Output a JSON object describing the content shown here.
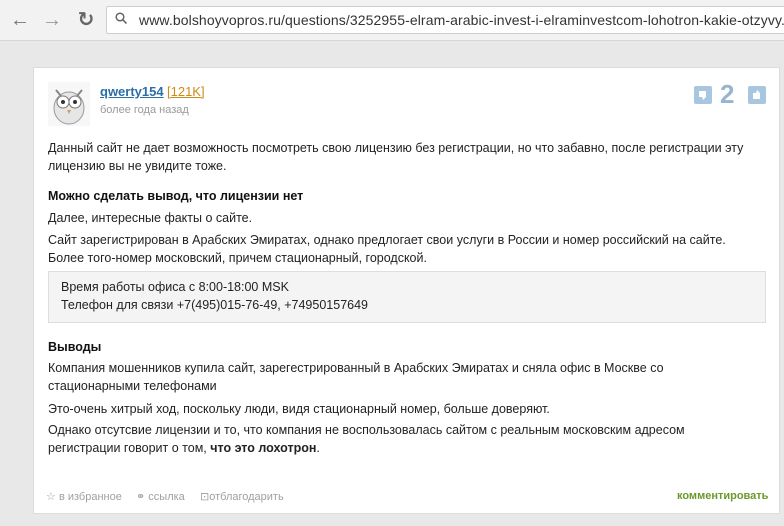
{
  "browser": {
    "url": "www.bolshoyvopros.ru/questions/3252955-elram-arabic-invest-i-elraminvestcom-lohotron-kakie-otzyvy.",
    "back": "←",
    "forward": "→",
    "reload": "↻"
  },
  "post": {
    "username": "qwerty154",
    "karma": "[121K]",
    "time": "более года назад",
    "votes": "2",
    "p1_l1": "Данный сайт не дает возможность посмотреть свою лицензию без регистрации, но что забавно, после регистрации эту",
    "p1_l2": "лицензию вы не увидите тоже.",
    "h1": "Можно сделать вывод, что лицензии нет",
    "p2": "Далее, интересные факты о сайте.",
    "p3_l1": "Сайт зарегистрирован в Арабских Эмиратах, однако предлогает свои услуги в России и номер российский на сайте.",
    "p3_l2": "Более того-номер московский, причем стационарный, городской.",
    "quote_l1": "Время работы офиса с 8:00-18:00 MSK",
    "quote_l2": "Телефон для связи +7(495)015-76-49, +74950157649",
    "h2": "Выводы",
    "p4_l1": "Компания мошенников купила сайт, зарегестрированный в Арабских Эмиратах и сняла офис в Москве со",
    "p4_l2": "стационарными телефонами",
    "p5": "Это-очень хитрый ход, поскольку люди, видя стационарный номер, больше доверяют.",
    "p6_l1": "Однако отсутсвие лицензии и то, что компания не воспользовалась сайтом с реальным московским адресом",
    "p6_l2_a": "регистрации говорит о том, ",
    "p6_l2_b": "что это лохотрон",
    "p6_l2_c": "."
  },
  "footer": {
    "favorite": "в избранное",
    "link": "ссылка",
    "thank": "отблагодарить",
    "comment": "комментировать"
  },
  "colors": {
    "link": "#2a6ea8",
    "karma": "#d08a18",
    "comment": "#6a9a2a",
    "vote": "#98b5cf"
  }
}
